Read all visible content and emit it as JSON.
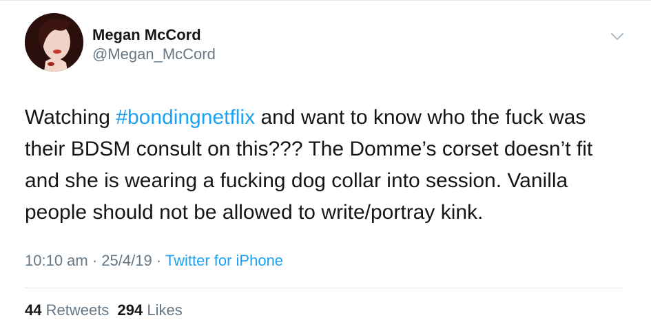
{
  "user": {
    "display_name": "Megan McCord",
    "handle": "@Megan_McCord"
  },
  "menu": {
    "icon": "chevron-down-icon"
  },
  "tweet": {
    "lines": [
      {
        "hashtag_prefix": "Watching ",
        "hashtag": "#bondingnetflix",
        "rest": " and want to know who the fuck was"
      },
      {
        "text": "their BDSM consult on this??? The Domme’s corset doesn’t fit"
      },
      {
        "text": "and she is wearing a fucking dog collar into session. Vanilla"
      },
      {
        "text": "people should not be allowed to write/portray kink."
      }
    ]
  },
  "meta": {
    "time": "10:10 am",
    "sep1": " · ",
    "date": "25/4/19",
    "sep2": " · ",
    "source": "Twitter for iPhone"
  },
  "stats": {
    "retweets_count": "44",
    "retweets_label": " Retweets",
    "likes_count": "294",
    "likes_label": " Likes"
  },
  "colors": {
    "link": "#1da1f2",
    "secondary": "#657786",
    "text": "#14171a",
    "divider": "#e1e8ed"
  }
}
